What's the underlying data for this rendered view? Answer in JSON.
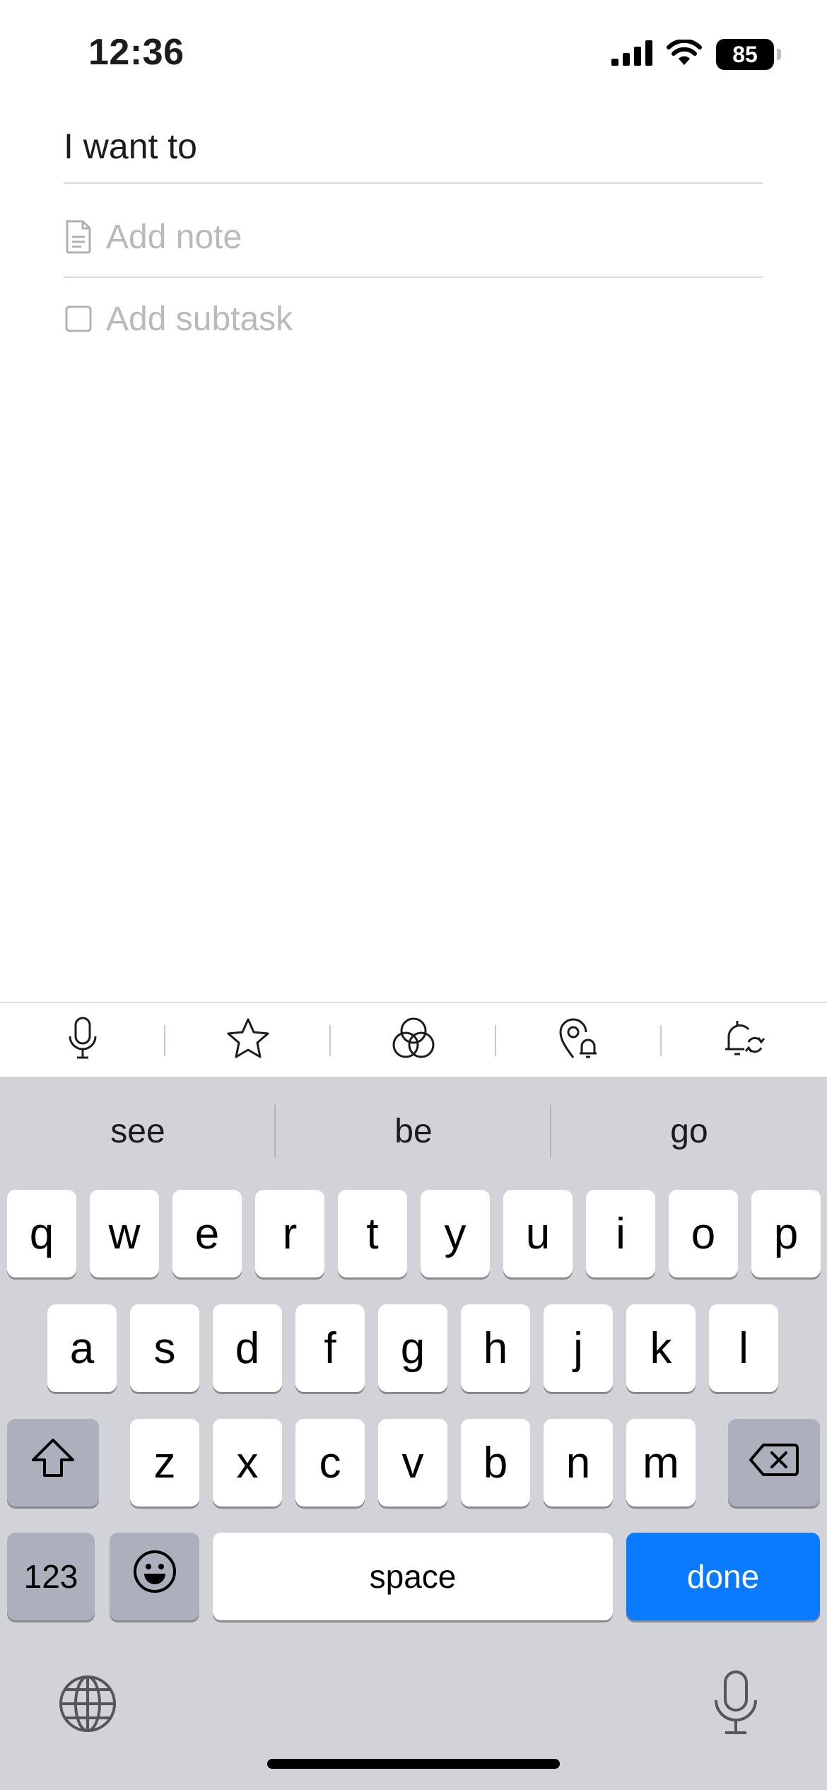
{
  "status_bar": {
    "time": "12:36",
    "battery": "85",
    "icons": [
      "cellular-signal-icon",
      "wifi-icon",
      "battery-icon"
    ]
  },
  "task_editor": {
    "title_value": "I want to",
    "note_placeholder": "Add note",
    "subtask_placeholder": "Add subtask"
  },
  "accessory_bar": {
    "icons": [
      "microphone-icon",
      "star-icon",
      "tags-icon",
      "location-reminder-icon",
      "recurring-reminder-icon"
    ]
  },
  "keyboard": {
    "suggestions": [
      "see",
      "be",
      "go"
    ],
    "row1": [
      "q",
      "w",
      "e",
      "r",
      "t",
      "y",
      "u",
      "i",
      "o",
      "p"
    ],
    "row2": [
      "a",
      "s",
      "d",
      "f",
      "g",
      "h",
      "j",
      "k",
      "l"
    ],
    "row3": [
      "z",
      "x",
      "c",
      "v",
      "b",
      "n",
      "m"
    ],
    "numbers_label": "123",
    "space_label": "space",
    "done_label": "done",
    "bottom_icons": [
      "globe-icon",
      "dictation-microphone-icon"
    ]
  },
  "colors": {
    "accent": "#0a7aff",
    "keyboard_background": "#d1d3d9",
    "placeholder": "#b9b9be"
  }
}
